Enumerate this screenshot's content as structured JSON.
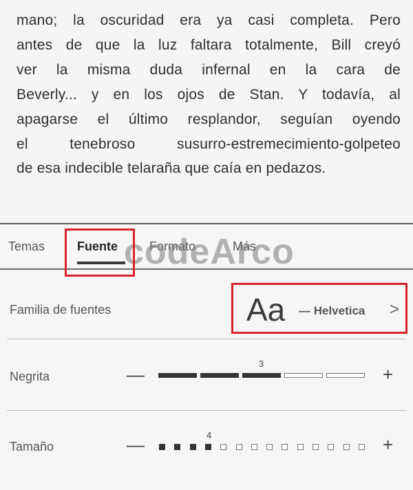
{
  "reading": {
    "lines": [
      "mano; la oscuridad era ya casi completa. Pero",
      "antes de que la luz faltara totalmente, Bill creyó",
      "ver la misma duda infernal en la cara de",
      "Beverly... y en los ojos de Stan. Y todavía, al",
      "apagarse el último resplandor, seguían oyendo",
      "el tenebroso susurro-estremecimiento-golpeteo",
      "de esa indecible telaraña que caía en pedazos."
    ]
  },
  "tabs": [
    {
      "label": "Temas",
      "active": false
    },
    {
      "label": "Fuente",
      "active": true
    },
    {
      "label": "Formato",
      "active": false
    },
    {
      "label": "Más",
      "active": false
    }
  ],
  "watermark": "codeArco",
  "font_family": {
    "label": "Familia de fuentes",
    "sample": "Aa",
    "current": "— Helvetica",
    "chevron": ">"
  },
  "bold": {
    "label": "Negrita",
    "level": "3",
    "max": 5,
    "minus": "—",
    "plus": "+"
  },
  "size": {
    "label": "Tamaño",
    "level": "4",
    "max": 14,
    "minus": "—",
    "plus": "+"
  },
  "colors": {
    "highlight": "#d8222a",
    "accent": "#333333"
  }
}
